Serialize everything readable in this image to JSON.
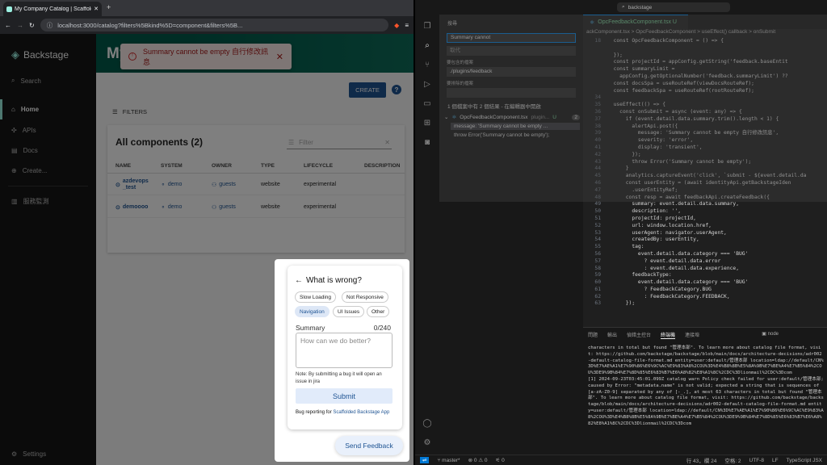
{
  "browser": {
    "tab_title": "My Company Catalog | Scaffolded Backstage App",
    "url": "localhost:3000/catalog?filters%5Bkind%5D=component&filters%5B..."
  },
  "sidebar": {
    "brand": "Backstage",
    "items": [
      {
        "label": "Search",
        "icon": "search-icon"
      },
      {
        "label": "Home",
        "icon": "home-icon"
      },
      {
        "label": "APIs",
        "icon": "puzzle-icon"
      },
      {
        "label": "Docs",
        "icon": "docs-icon"
      },
      {
        "label": "Create...",
        "icon": "add-icon"
      },
      {
        "label": "服務監測",
        "icon": "chart-icon"
      }
    ],
    "settings": "Settings"
  },
  "header": {
    "title": "My"
  },
  "toast": {
    "message": "Summary cannot be empty 自行修改訊息"
  },
  "toolbar": {
    "create_label": "CREATE",
    "help_label": "?"
  },
  "filters_label": "FILTERS",
  "catalog": {
    "title": "All components (2)",
    "filter_placeholder": "Filter",
    "columns": [
      "NAME",
      "SYSTEM",
      "OWNER",
      "TYPE",
      "LIFECYCLE",
      "DESCRIPTION"
    ],
    "rows": [
      {
        "name": "azdevops_test",
        "system": "demo",
        "owner": "guests",
        "type": "website",
        "lifecycle": "experimental"
      },
      {
        "name": "demoooo",
        "system": "demo",
        "owner": "guests",
        "type": "website",
        "lifecycle": "experimental"
      }
    ]
  },
  "feedback": {
    "title": "What is wrong?",
    "chips": [
      "Slow Loading",
      "Not Responsive",
      "Navigation",
      "UI Issues",
      "Other"
    ],
    "selected_chip": "Navigation",
    "summary_label": "Summary",
    "summary_count": "0/240",
    "summary_placeholder": "How can we do better?",
    "note": "Note: By submitting a bug it will open an issue in jira",
    "submit_label": "Submit",
    "bug_report_prefix": "Bug reporting for ",
    "bug_report_link": "Scaffolded Backstage App",
    "send_feedback_label": "Send Feedback"
  },
  "vscode": {
    "search_box": "backstage",
    "search_panel": {
      "title": "搜尋",
      "query": "Summary cannot",
      "replace_placeholder": "取代",
      "include_label": "要包含的檔案",
      "include_value": "./plugins/feedback",
      "exclude_label": "要排除的檔案",
      "result_summary": "1 個檔案中有 2 個結果 - 在編輯器中開啟",
      "file_name": "OpcFeedbackComponent.tsx",
      "file_path": "plugin...",
      "file_badge": "U",
      "file_count": "2",
      "match1": "message: 'Summary cannot be empty ...",
      "match2": "throw Error('Summary cannot be empty');"
    },
    "editor_tab": "OpcFeedbackComponent.tsx U",
    "breadcrumb": "ackComponent.tsx > OpcFeedbackComponent > useEffect() callback > onSubmit",
    "code_lines": [
      {
        "n": "18",
        "t": "  const OpcFeedbackComponent = () => {"
      },
      {
        "n": "",
        "t": "  "
      },
      {
        "n": "",
        "t": "  });"
      },
      {
        "n": "",
        "t": "  const projectId = appConfig.getString('feedback.baseEntit"
      },
      {
        "n": "",
        "t": "  const summaryLimit ="
      },
      {
        "n": "",
        "t": "    appConfig.getOptionalNumber('feedback.summaryLimit') ??"
      },
      {
        "n": "",
        "t": "  const docsSpa = useRouteRef(viewDocsRouteRef);"
      },
      {
        "n": "",
        "t": "  const feedbackSpa = useRouteRef(rootRouteRef);"
      },
      {
        "n": "34",
        "t": ""
      },
      {
        "n": "35",
        "t": "  useEffect(() => {"
      },
      {
        "n": "36",
        "t": "    const onSubmit = async (event: any) => {"
      },
      {
        "n": "37",
        "t": "      if (event.detail.data.summary.trim().length < 1) {"
      },
      {
        "n": "38",
        "t": "        alertApi.post({"
      },
      {
        "n": "39",
        "t": "          message: 'Summary cannot be empty 自行修改訊息',"
      },
      {
        "n": "40",
        "t": "          severity: 'error',"
      },
      {
        "n": "41",
        "t": "          display: 'transient',"
      },
      {
        "n": "42",
        "t": "        });"
      },
      {
        "n": "43",
        "t": "        throw Error('Summary cannot be empty');"
      },
      {
        "n": "44",
        "t": "      }"
      },
      {
        "n": "45",
        "t": "      analytics.captureEvent('click', `submit - ${event.detail.da"
      },
      {
        "n": "46",
        "t": "      const userEntity = (await identityApi.getBackstageIden"
      },
      {
        "n": "47",
        "t": "        .userEntityRef;"
      },
      {
        "n": "48",
        "t": "      const resp = await feedbackApi.createFeedback({"
      },
      {
        "n": "49",
        "t": "        summary: event.detail.data.summary,"
      },
      {
        "n": "50",
        "t": "        description: '',"
      },
      {
        "n": "51",
        "t": "        projectId: projectId,"
      },
      {
        "n": "52",
        "t": "        url: window.location.href,"
      },
      {
        "n": "53",
        "t": "        userAgent: navigator.userAgent,"
      },
      {
        "n": "54",
        "t": "        createdBy: userEntity,"
      },
      {
        "n": "55",
        "t": "        tag:"
      },
      {
        "n": "56",
        "t": "          event.detail.data.category === 'BUG'"
      },
      {
        "n": "57",
        "t": "            ? event.detail.data.error"
      },
      {
        "n": "58",
        "t": "            : event.detail.data.experience,"
      },
      {
        "n": "59",
        "t": "        feedbackType:"
      },
      {
        "n": "60",
        "t": "          event.detail.data.category === 'BUG'"
      },
      {
        "n": "61",
        "t": "            ? FeedbackCategory.BUG"
      },
      {
        "n": "62",
        "t": "            : FeedbackCategory.FEEDBACK,"
      },
      {
        "n": "63",
        "t": "      });"
      }
    ],
    "panel_tabs": [
      "問題",
      "輸出",
      "偵錯主控台",
      "終端機",
      "連接埠"
    ],
    "terminal_shell": "node",
    "terminal_text": "characters in total but found \"管理本部\". To learn more about catalog file format, visit: https://github.com/backstage/backstage/blob/main/docs/architecture-decisions/adr002-default-catalog-file-format.md entity=user:default/管理本部 location=ldap://default/CN%3D%E7%AE%A1%E7%90%86%E6%9C%AC%E9%83%A8%2COU%3D%E4%B8%8B%E5%8A%9B%E7%BE%A4%E7%B5%84%2COU%3DE9%9B%84%E7%8D%85%E6%83%B7%E6%A8%82%E8%A1%8C%2CDC%3Dlionmail%2CDC%3Dcom\n[1] 2024-09-23T03:45:01.099Z catalog warn Policy check failed for user:default/管理本部; caused by Error: \"metadata.name\" is not valid; expected a string that is sequences of [a-zA-Z0-9] separated by any of [-_.], at most 63 characters in total but found \"管理本部\". To learn more about catalog file format, visit: https://github.com/backstage/backstage/blob/main/docs/architecture-decisions/adr002-default-catalog-file-format.md entity=user:default/管理本部 location=ldap://default/CN%3D%E7%AE%A1%E7%90%86%E6%9C%AC%E9%83%A8%2COU%3D%E4%B8%8B%E5%8A%9B%E7%BE%A4%E7%B5%84%2COU%3DE9%9B%84%E7%8D%85%E6%83%B7%E6%A8%82%E8%A1%8C%2CDC%3Dlionmail%2CDC%3Dcom",
    "status": {
      "branch": "master*",
      "problems": "⊗ 0 ⚠ 0",
      "ports": "0",
      "position": "行 43，欄 24",
      "spaces": "空格: 2",
      "encoding": "UTF-8",
      "eol": "LF",
      "language": "TypeScript JSX"
    }
  },
  "colors": {
    "accent": "#1f5493",
    "header": "#005b4b",
    "error_bg": "#fdecea",
    "error_fg": "#a61b1b"
  }
}
